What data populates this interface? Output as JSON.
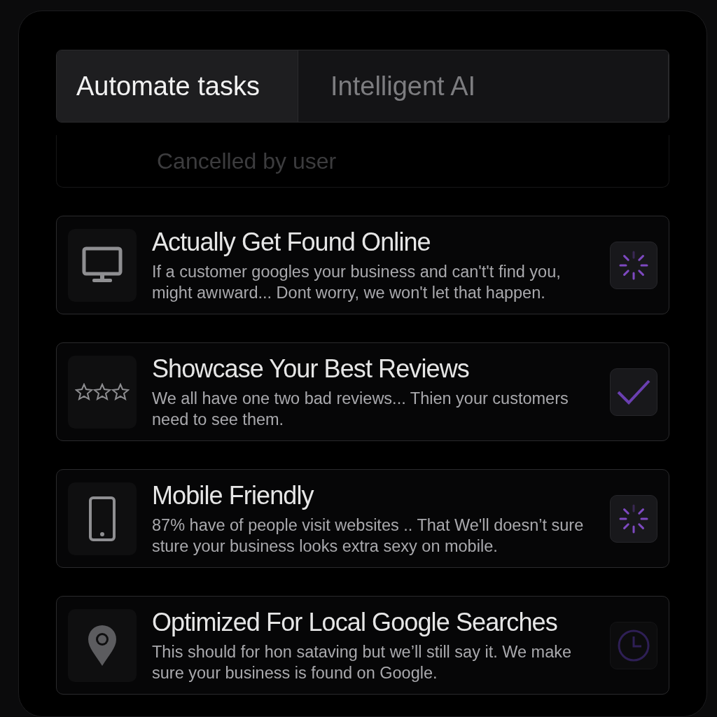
{
  "tabs": [
    {
      "label": "Automate tasks",
      "selected": true
    },
    {
      "label": "Intelligent AI",
      "selected": false
    }
  ],
  "cancelled_row": {
    "label": "Cancelled by user"
  },
  "features": [
    {
      "kind": "monitor",
      "title": "Actually Get Found Online",
      "description": "If a customer googles your business and can't't find you, might awıward... Dont worry, we won't let that happen.",
      "done": false,
      "loading": true
    },
    {
      "kind": "stars",
      "title": "Showcase Your Best Reviews",
      "description": "We all have one two bad reviews... Thien your customers need to see them.",
      "done": true,
      "loading": false
    },
    {
      "kind": "phone",
      "title": "Mobile Friendly",
      "description": "87% have of people visit websites  .. That We'll doesn’t sure sture your business looks extra sexy on mobile.",
      "done": false,
      "loading": true
    },
    {
      "kind": "pin",
      "title": "Optimized For Local Google Searches",
      "description": "This should for hon sataving but we’ll still say it. We make sure your business is found on Google.",
      "done": false,
      "loading": false
    }
  ]
}
